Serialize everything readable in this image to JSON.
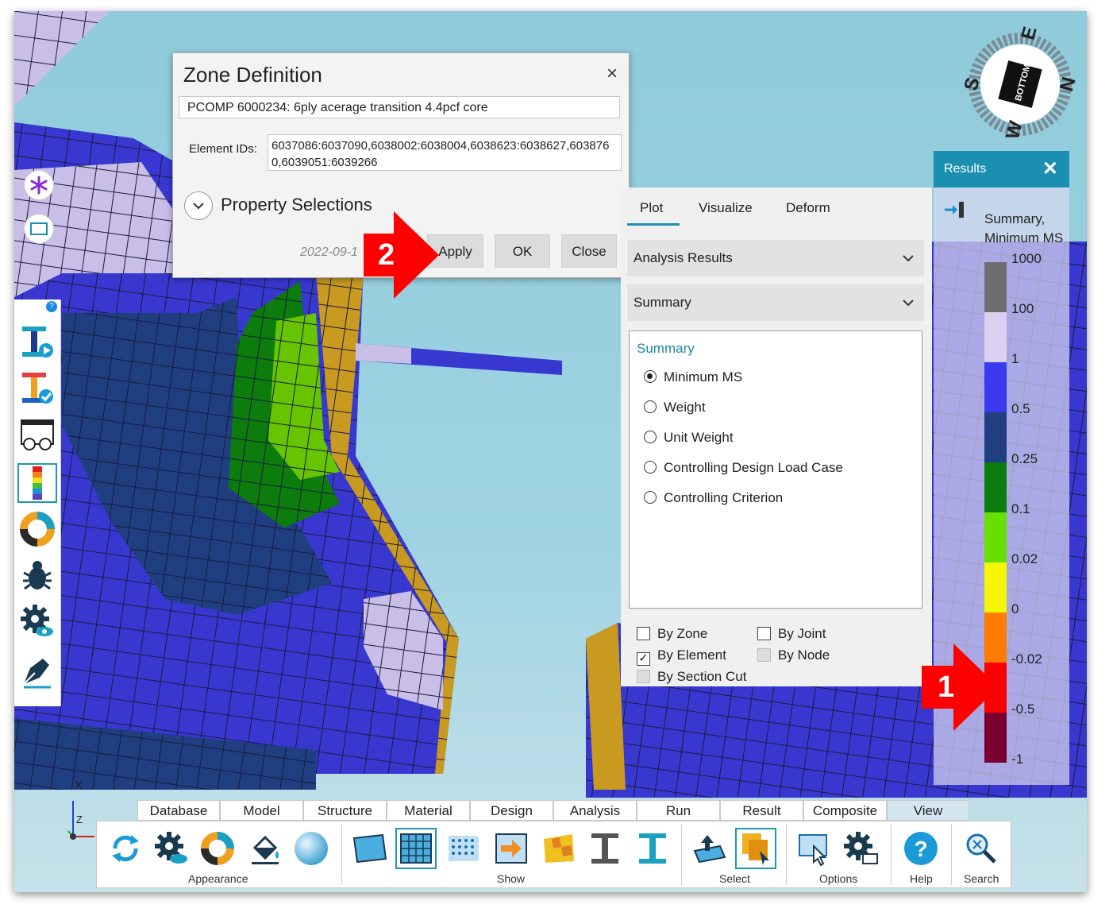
{
  "dialog": {
    "title": "Zone Definition",
    "close_glyph": "×",
    "zone_name": "PCOMP 6000234: 6ply acerage transition 4.4pcf core",
    "element_ids_label": "Element IDs:",
    "element_ids_value": "6037086:6037090,6038002:6038004,6038623:6038627,6038760,6039051:6039266",
    "property_selections_label": "Property Selections",
    "date_text": "2022-09-1",
    "buttons": {
      "apply": "Apply",
      "ok": "OK",
      "close": "Close"
    }
  },
  "callouts": {
    "step1": "1",
    "step2": "2"
  },
  "plot_panel": {
    "tabs": [
      "Plot",
      "Visualize",
      "Deform"
    ],
    "active_tab": "Plot",
    "dropdown_analysis": "Analysis Results",
    "dropdown_summary": "Summary",
    "summary_header": "Summary",
    "options": [
      "Minimum MS",
      "Weight",
      "Unit Weight",
      "Controlling Design Load Case",
      "Controlling Criterion"
    ],
    "selected_option": "Minimum MS",
    "checkboxes": {
      "by_zone": {
        "label": "By Zone",
        "checked": false
      },
      "by_joint": {
        "label": "By Joint",
        "checked": false
      },
      "by_element": {
        "label": "By Element",
        "checked": true
      },
      "by_node": {
        "label": "By Node",
        "checked": false,
        "disabled": true
      },
      "by_section_cut": {
        "label": "By Section Cut",
        "checked": false,
        "disabled": true
      }
    },
    "check_glyph": "✓"
  },
  "results_panel": {
    "title": "Results",
    "close_glyph": "✕",
    "subtitle_line1": "Summary,",
    "subtitle_line2": "Minimum MS",
    "legend_labels": [
      "1000",
      "100",
      "1",
      "0.5",
      "0.25",
      "0.1",
      "0.02",
      "0",
      "-0.02",
      "-0.5",
      "-1"
    ],
    "legend_colors": [
      "#6e6e6e",
      "#dcd0f0",
      "#3a3af0",
      "#1f3f80",
      "#0c7c0c",
      "#66e000",
      "#f7f700",
      "#ff7c00",
      "#ff0000",
      "#7a0030"
    ]
  },
  "compass": {
    "cube_label": "BOTTOM",
    "letters": {
      "top": "E",
      "right": "N",
      "bottom": "W",
      "left": "S"
    }
  },
  "axis_triad": {
    "x": "X",
    "z": "Z"
  },
  "ribbon": {
    "tabs": [
      "Database",
      "Model",
      "Structure",
      "Material",
      "Design",
      "Analysis",
      "Run",
      "Result",
      "Composite",
      "View"
    ],
    "active_tab": "View",
    "groups": [
      "Appearance",
      "Show",
      "Select",
      "Options",
      "Help",
      "Search"
    ]
  },
  "left_toolbar": {
    "help_glyph": "?",
    "icons": [
      "beam-run-icon",
      "beam-check-icon",
      "glasses-view-icon",
      "color-legend-icon",
      "donut-chart-icon",
      "bug-icon",
      "gear-eye-icon",
      "pen-nib-icon"
    ]
  }
}
